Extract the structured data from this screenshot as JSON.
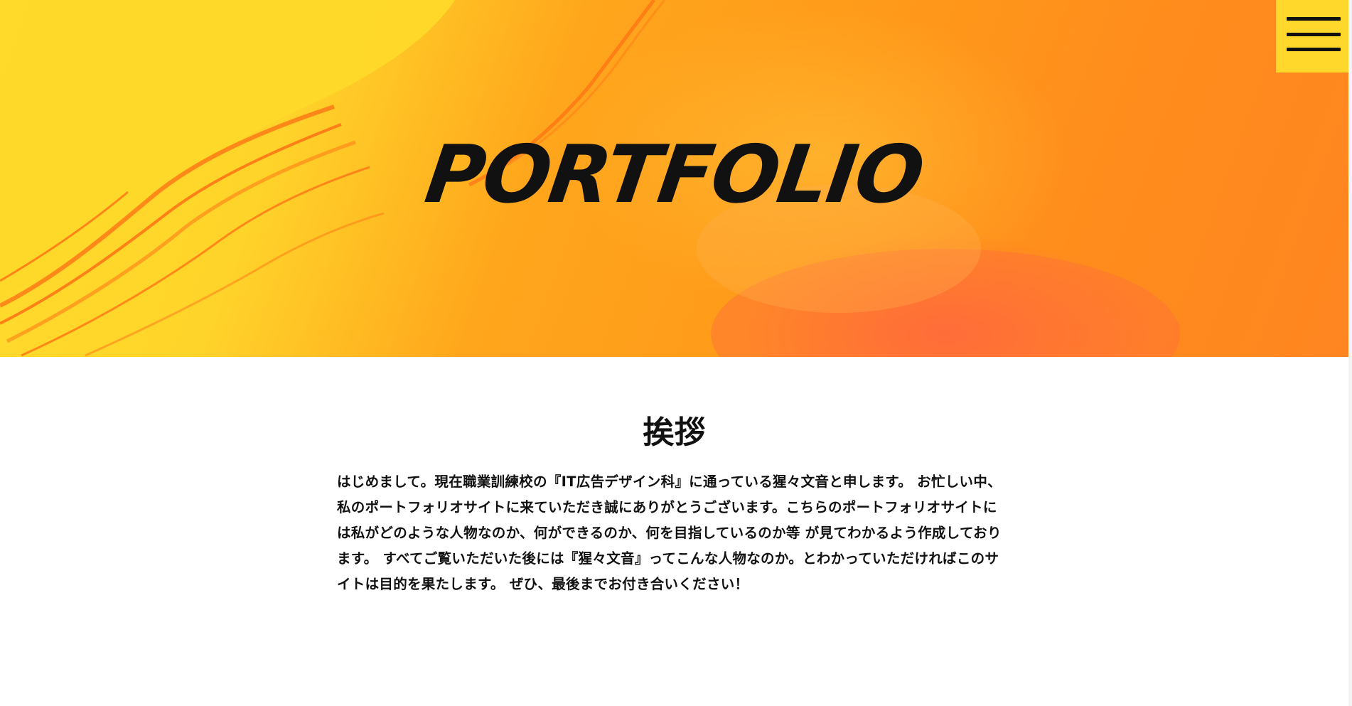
{
  "hero": {
    "title": "PORTFOLIO",
    "colors": {
      "yellow": "#ffd42a",
      "orange": "#ff9a1a",
      "red_orange": "#ff6a3a"
    }
  },
  "menu": {
    "icon": "hamburger-menu-icon",
    "background": "#ffd82b"
  },
  "greeting": {
    "heading": "挨拶",
    "body": "はじめまして。現在職業訓練校の『IT広告デザイン科』に通っている猩々文音と申します。 お忙しい中、私のポートフォリオサイトに来ていただき誠にありがとうございます。こちらのポートフォリオサイトには私がどのような人物なのか、何ができるのか、何を目指しているのか等 が見てわかるよう作成しております。 すべてご覧いただいた後には『猩々文音』ってこんな人物なのか。とわかっていただければこのサイトは目的を果たします。 ぜひ、最後までお付き合いください！"
  }
}
